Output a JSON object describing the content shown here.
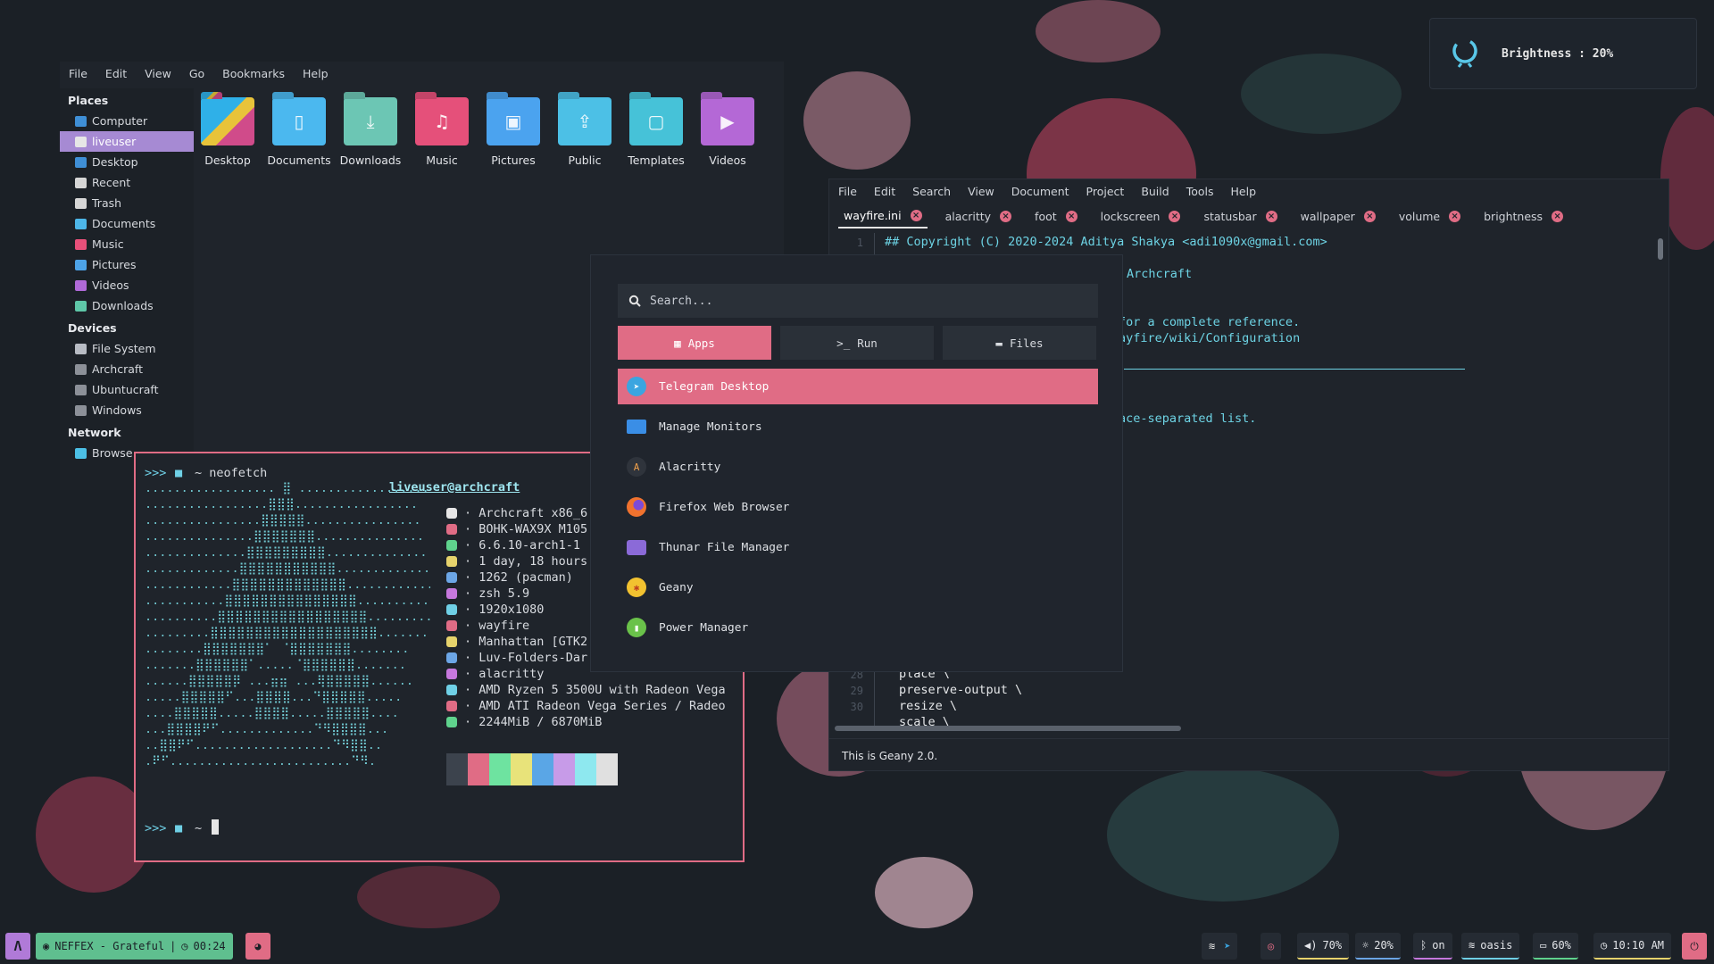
{
  "osd": {
    "label": "Brightness : 20%",
    "level": 0.2
  },
  "thunar": {
    "menu": [
      "File",
      "Edit",
      "View",
      "Go",
      "Bookmarks",
      "Help"
    ],
    "places_header": "Places",
    "places": [
      {
        "label": "Computer",
        "icon": "computer-icon",
        "color": "#3f8fd6"
      },
      {
        "label": "liveuser",
        "icon": "home-icon",
        "color": "#e6e6e6"
      },
      {
        "label": "Desktop",
        "icon": "desktop-icon",
        "color": "#3f8fd6"
      },
      {
        "label": "Recent",
        "icon": "recent-icon",
        "color": "#d6d6d6"
      },
      {
        "label": "Trash",
        "icon": "trash-icon",
        "color": "#d6d6d6"
      },
      {
        "label": "Documents",
        "icon": "folder-documents-icon",
        "color": "#4db6e8"
      },
      {
        "label": "Music",
        "icon": "folder-music-icon",
        "color": "#e8507a"
      },
      {
        "label": "Pictures",
        "icon": "folder-pictures-icon",
        "color": "#4da3e8"
      },
      {
        "label": "Videos",
        "icon": "folder-videos-icon",
        "color": "#b06ad8"
      },
      {
        "label": "Downloads",
        "icon": "folder-downloads-icon",
        "color": "#5ec7a8"
      }
    ],
    "devices_header": "Devices",
    "devices": [
      "File System",
      "Archcraft",
      "Ubuntucraft",
      "Windows"
    ],
    "network_header": "Network",
    "network": [
      "Browse"
    ],
    "folders": [
      {
        "label": "Desktop",
        "icon": "desktop-folder-icon",
        "color": "#3b8fd9"
      },
      {
        "label": "Documents",
        "icon": "documents-folder-icon",
        "color": "#4bb8ef"
      },
      {
        "label": "Downloads",
        "icon": "downloads-folder-icon",
        "color": "#6cc6b4"
      },
      {
        "label": "Music",
        "icon": "music-folder-icon",
        "color": "#e5507a"
      },
      {
        "label": "Pictures",
        "icon": "pictures-folder-icon",
        "color": "#4ba3ef"
      },
      {
        "label": "Public",
        "icon": "public-folder-icon",
        "color": "#4cc0e6"
      },
      {
        "label": "Templates",
        "icon": "templates-folder-icon",
        "color": "#46c2d8"
      },
      {
        "label": "Videos",
        "icon": "videos-folder-icon",
        "color": "#b468d6"
      }
    ]
  },
  "geany": {
    "menu": [
      "File",
      "Edit",
      "Search",
      "View",
      "Document",
      "Project",
      "Build",
      "Tools",
      "Help"
    ],
    "tabs": [
      "wayfire.ini",
      "alacritty",
      "foot",
      "lockscreen",
      "statusbar",
      "wallpaper",
      "volume",
      "brightness"
    ],
    "line1_no": "1",
    "line1": "## Copyright (C) 2020-2024 Aditya Shakya <adi1090x@gmail.com>",
    "frag1": "Archcraft",
    "frag2": "for a complete reference.",
    "frag3": "ayfire/wiki/Configuration",
    "frag4": "ace-separated list.",
    "bottom_lines": [
      {
        "no": "28",
        "text": "place \\"
      },
      {
        "no": "29",
        "text": "preserve-output \\"
      },
      {
        "no": "30",
        "text": "resize \\"
      },
      {
        "no": "",
        "text": "scale \\"
      }
    ],
    "status": "This is Geany 2.0."
  },
  "terminal": {
    "prompt": ">>>",
    "command": "~ neofetch",
    "prompt2": "~",
    "user_host": "liveuser@archcraft",
    "info": [
      {
        "icon": "os-icon",
        "color": "#e6e6e6",
        "text": "· Archcraft x86_6"
      },
      {
        "icon": "host-icon",
        "color": "#e06c85",
        "text": "· BOHK-WAX9X M105"
      },
      {
        "icon": "kernel-icon",
        "color": "#5fd38d",
        "text": "· 6.6.10-arch1-1"
      },
      {
        "icon": "uptime-icon",
        "color": "#e6d36c",
        "text": "· 1 day, 18 hours"
      },
      {
        "icon": "packages-icon",
        "color": "#6ca6e6",
        "text": "· 1262 (pacman)"
      },
      {
        "icon": "shell-icon",
        "color": "#c678dd",
        "text": "· zsh 5.9"
      },
      {
        "icon": "resolution-icon",
        "color": "#6fd0e6",
        "text": "· 1920x1080"
      },
      {
        "icon": "wm-icon",
        "color": "#e06c85",
        "text": "· wayfire"
      },
      {
        "icon": "theme-icon",
        "color": "#e6d36c",
        "text": "· Manhattan [GTK2"
      },
      {
        "icon": "icons-icon",
        "color": "#6ca6e6",
        "text": "· Luv-Folders-Dar"
      },
      {
        "icon": "terminal-icon",
        "color": "#c678dd",
        "text": "· alacritty"
      },
      {
        "icon": "cpu-icon",
        "color": "#6fd0e6",
        "text": "· AMD Ryzen 5 3500U with Radeon Vega"
      },
      {
        "icon": "gpu-icon",
        "color": "#e06c85",
        "text": "· AMD ATI Radeon Vega Series / Radeo"
      },
      {
        "icon": "memory-icon",
        "color": "#5fd38d",
        "text": "· 2244MiB / 6870MiB"
      }
    ],
    "palette": [
      "#3c434d",
      "#e06c85",
      "#6ee3a0",
      "#e8e37a",
      "#5aa6e6",
      "#c79be8",
      "#8ee8ef",
      "#e0e0e0"
    ]
  },
  "launcher": {
    "search_placeholder": "Search...",
    "modes": [
      "Apps",
      "Run",
      "Files"
    ],
    "entries": [
      {
        "label": "Telegram Desktop",
        "icon": "telegram-icon",
        "color": "#3ba5e0"
      },
      {
        "label": "Manage Monitors",
        "icon": "monitor-icon",
        "color": "#3a8ee6"
      },
      {
        "label": "Alacritty",
        "icon": "alacritty-icon",
        "color": "#2f343c"
      },
      {
        "label": "Firefox Web Browser",
        "icon": "firefox-icon",
        "color": "#f0722e"
      },
      {
        "label": "Thunar File Manager",
        "icon": "thunar-icon",
        "color": "#8b6ad8"
      },
      {
        "label": "Geany",
        "icon": "geany-icon",
        "color": "#f2c230"
      },
      {
        "label": "Power Manager",
        "icon": "power-manager-icon",
        "color": "#6ac24a"
      }
    ]
  },
  "taskbar": {
    "music": "NEFFEX - Grateful",
    "time_elapsed": "00:24",
    "volume": "70%",
    "brightness": "20%",
    "bluetooth": "on",
    "network": "oasis",
    "battery": "60%",
    "clock": "10:10 AM"
  }
}
